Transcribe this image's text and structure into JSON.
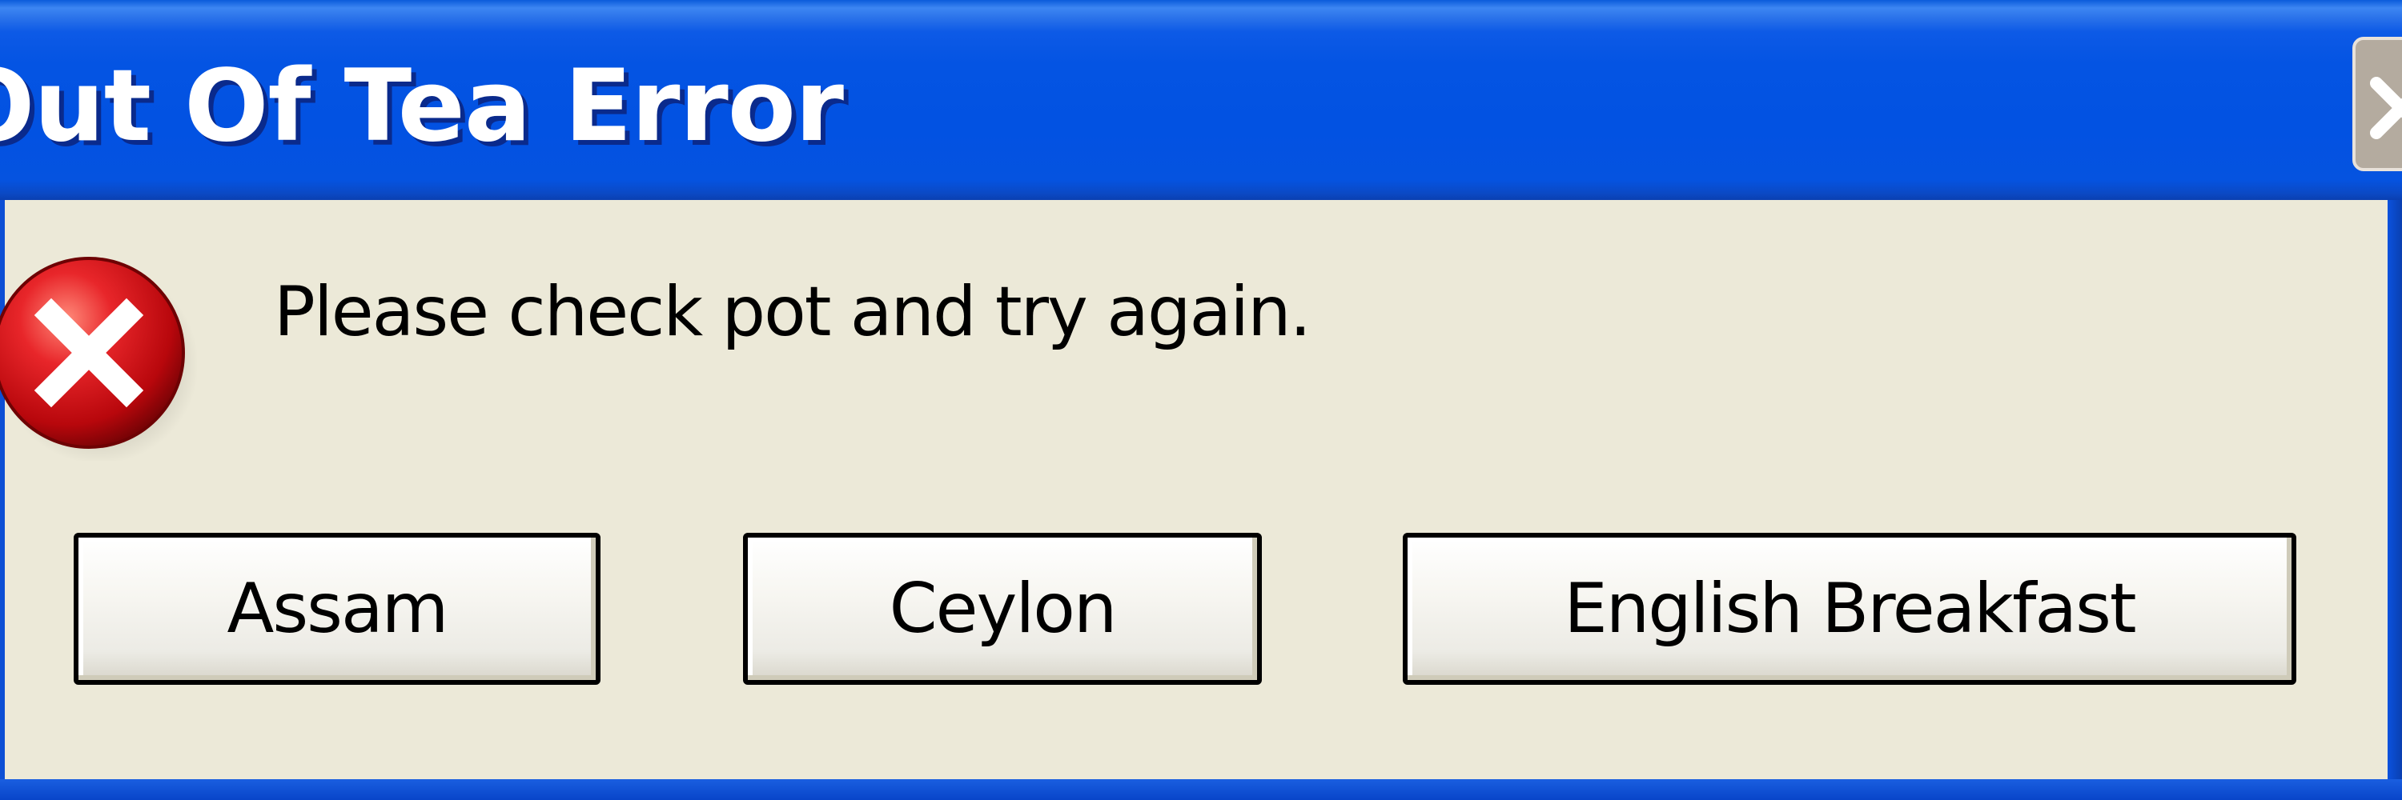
{
  "window": {
    "title": "Out Of Tea Error",
    "close_icon": "close-icon"
  },
  "dialog": {
    "icon": "error-icon",
    "message": "Please check pot and try again."
  },
  "buttons": [
    {
      "label": "Assam"
    },
    {
      "label": "Ceylon"
    },
    {
      "label": "English Breakfast"
    }
  ],
  "colors": {
    "titlebar": "#0454E3",
    "dialog_background": "#ECE9D8",
    "error_red": "#D8141C",
    "close_button": "#B4AB9F"
  }
}
